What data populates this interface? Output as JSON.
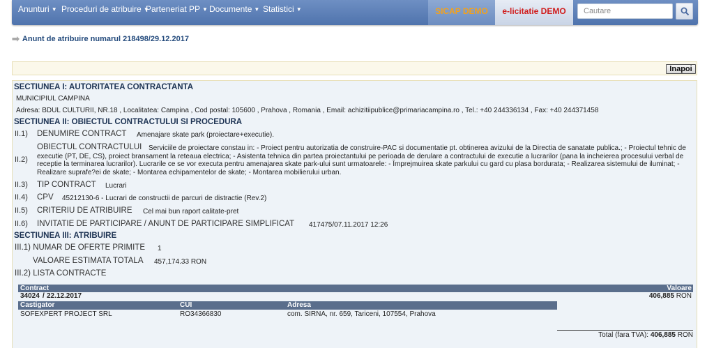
{
  "nav": {
    "items": [
      "Anunturi",
      "Proceduri de atribuire",
      "Parteneriat PP",
      "Documente",
      "Statistici"
    ],
    "sicap": "SICAP DEMO",
    "elicitatie": "e-licitatie DEMO",
    "search_placeholder": "Cautare"
  },
  "colors": {
    "nav_bg": "#5c7fb7",
    "sicap_text": "#f3a11c",
    "elic_text": "#d01d1d",
    "heading": "#234a7c",
    "table_header": "#5a6e8c"
  },
  "icons": {
    "search": "search-icon",
    "heading_arrow": "arrow-right-icon"
  },
  "heading": "Anunt de atribuire numarul 218498/29.12.2017",
  "back_button": "Inapoi",
  "section1": {
    "title": "SECTIUNEA I: AUTORITATEA CONTRACTANTA",
    "authority": "MUNICIPIUL CAMPINA",
    "address_line": "Adresa:  BDUL CULTURII, NR.18 , Localitatea:  Campina , Cod postal:  105600 , Prahova , Romania , Email:  achizitiipublice@primariacampina.ro , Tel.:  +40 244336134 , Fax:  +40 244371458"
  },
  "section2": {
    "title": "SECTIUNEA II: OBIECTUL CONTRACTULUI SI PROCEDURA",
    "rows": [
      {
        "num": "II.1)",
        "label": "DENUMIRE CONTRACT",
        "value": "Amenajare skate park (proiectare+executie)."
      },
      {
        "num": "II.2)",
        "label": "OBIECTUL CONTRACTULUI",
        "value": "Serviciile de proiectare constau in: - Proiect pentru autorizatia de construire-PAC si documentatie pt. obtinerea avizului de la Directia de sanatate publica.; - Proiectul tehnic de executie (PT, DE, CS), proiect bransament la reteaua electrica; - Asistenta tehnica din partea proiectantului pe perioada de derulare a contractului de executie a lucrarilor (pana la incheierea procesului verbal de receptie la terminarea lucrarilor). Lucrarile ce se vor executa pentru amenajarea skate park-ului sunt urmatoarele: - Împrejmuirea skate parkului cu gard cu plasa bordurata; - Realizarea sistemului de iluminat; - Realizare suprafe?ei de skate; - Montarea echipamentelor de skate; - Montarea mobilierului urban."
      },
      {
        "num": "II.3)",
        "label": "TIP CONTRACT",
        "value": "Lucrari"
      },
      {
        "num": "II.4)",
        "label": "CPV",
        "value": "45212130-6 - Lucrari de constructii de parcuri de distractie (Rev.2)"
      },
      {
        "num": "II.5)",
        "label": "CRITERIU DE ATRIBUIRE",
        "value": "Cel mai bun raport calitate-pret"
      },
      {
        "num": "II.6)",
        "label": "INVITATIE DE PARTICIPARE / ANUNT DE PARTICIPARE SIMPLIFICAT",
        "value": "417475/07.11.2017 12:26"
      }
    ]
  },
  "section3": {
    "title": "SECTIUNEA III: ATRIBUIRE",
    "offers_label": "III.1) NUMAR DE OFERTE PRIMITE",
    "offers_value": "1",
    "estimated_label": "VALOARE ESTIMATA TOTALA",
    "estimated_value": "457,174.33 RON",
    "contracts_label": "III.2) LISTA CONTRACTE"
  },
  "contract_table": {
    "headers": {
      "contract": "Contract",
      "value": "Valoare"
    },
    "row": {
      "number": "34024",
      "separator": "/",
      "date": "22.12.2017",
      "value": "406,885",
      "currency": "RON"
    },
    "winner_headers": {
      "winner": "Castigator",
      "cui": "CUI",
      "address": "Adresa"
    },
    "winner": {
      "name": "SOFEXPERT PROJECT SRL",
      "cui": "RO34366830",
      "address": "com. SIRNA, nr. 659, Tariceni, 107554, Prahova"
    },
    "total_label": "Total (fara TVA):",
    "total_value": "406,885",
    "total_currency": "RON"
  }
}
